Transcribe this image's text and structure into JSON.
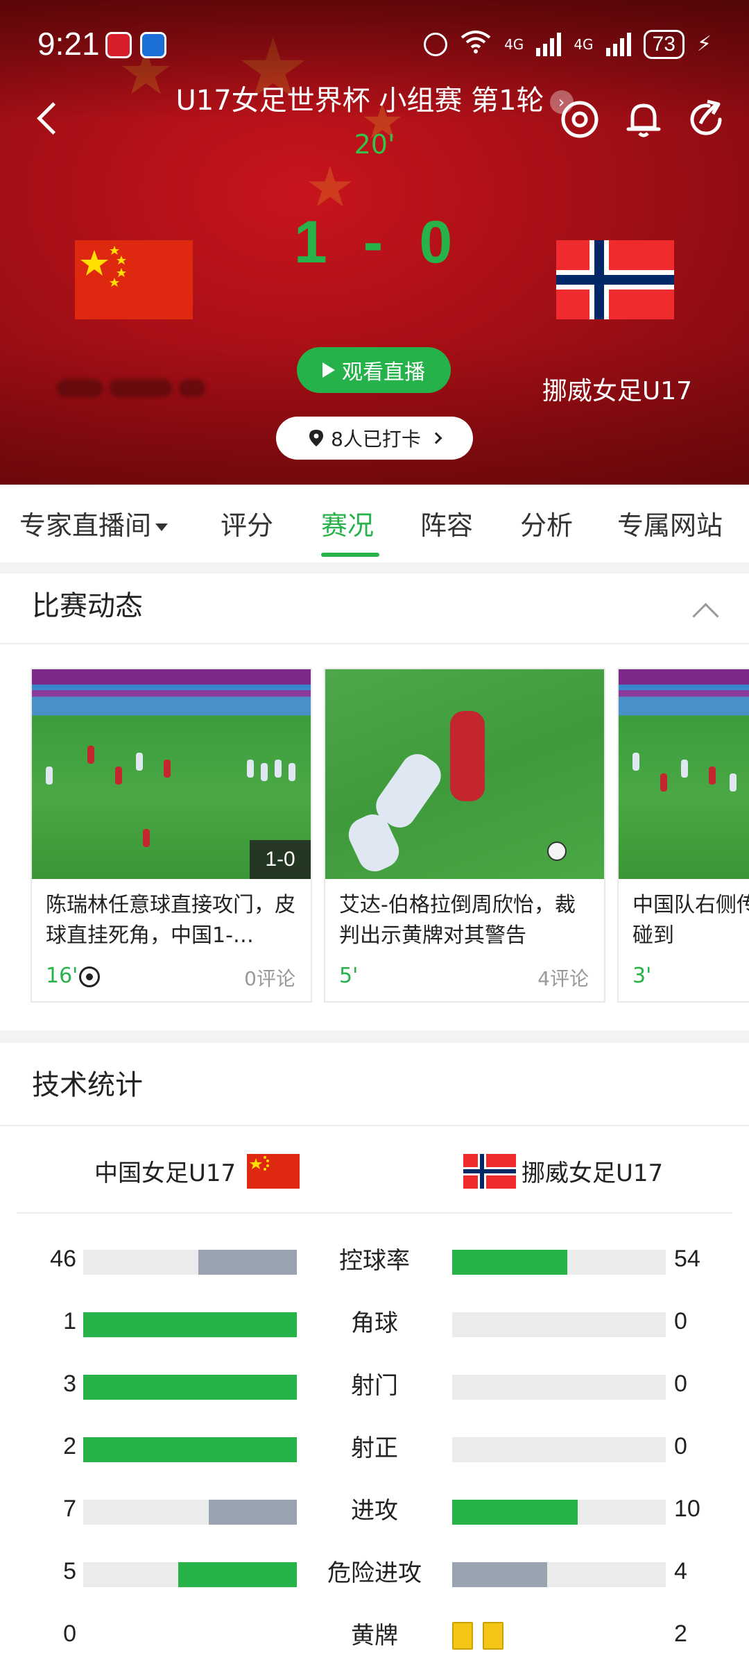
{
  "status_bar": {
    "time": "9:21",
    "network_badge": "4G",
    "battery": "73"
  },
  "header": {
    "match_title": "U17女足世界杯 小组赛 第1轮",
    "minute": "20'",
    "score_home": "1",
    "score_separator": "-",
    "score_away": "0",
    "watch_live_label": "观看直播",
    "checkin_label": "8人已打卡",
    "away_team_name": "挪威女足U17"
  },
  "tabs": [
    {
      "label": "专家直播间"
    },
    {
      "label": "评分"
    },
    {
      "label": "赛况"
    },
    {
      "label": "阵容"
    },
    {
      "label": "分析"
    },
    {
      "label": "专属网站"
    }
  ],
  "match_events": {
    "title": "比赛动态",
    "cards": [
      {
        "text": "陈瑞林任意球直接攻门，皮球直挂死角，中国1-…",
        "minute": "16'",
        "comments": "0评论",
        "score_tag": "1-0"
      },
      {
        "text": "艾达-伯格拉倒周欣怡，裁判出示黄牌对其警告",
        "minute": "5'",
        "comments": "4评论"
      },
      {
        "text": "中国队右侧传中，抄队员未碰到",
        "minute": "3'",
        "comments": ""
      }
    ]
  },
  "stats": {
    "title": "技术统计",
    "home_team": "中国女足U17",
    "away_team": "挪威女足U17",
    "colors": {
      "leader": "#27b24a",
      "trailer": "#9aa3b2",
      "track": "#ebebeb"
    },
    "rows": [
      {
        "label": "控球率",
        "home": "46",
        "away": "54"
      },
      {
        "label": "角球",
        "home": "1",
        "away": "0"
      },
      {
        "label": "射门",
        "home": "3",
        "away": "0"
      },
      {
        "label": "射正",
        "home": "2",
        "away": "0"
      },
      {
        "label": "进攻",
        "home": "7",
        "away": "10"
      },
      {
        "label": "危险进攻",
        "home": "5",
        "away": "4"
      },
      {
        "label": "黄牌",
        "home": "0",
        "away": "2"
      }
    ]
  }
}
